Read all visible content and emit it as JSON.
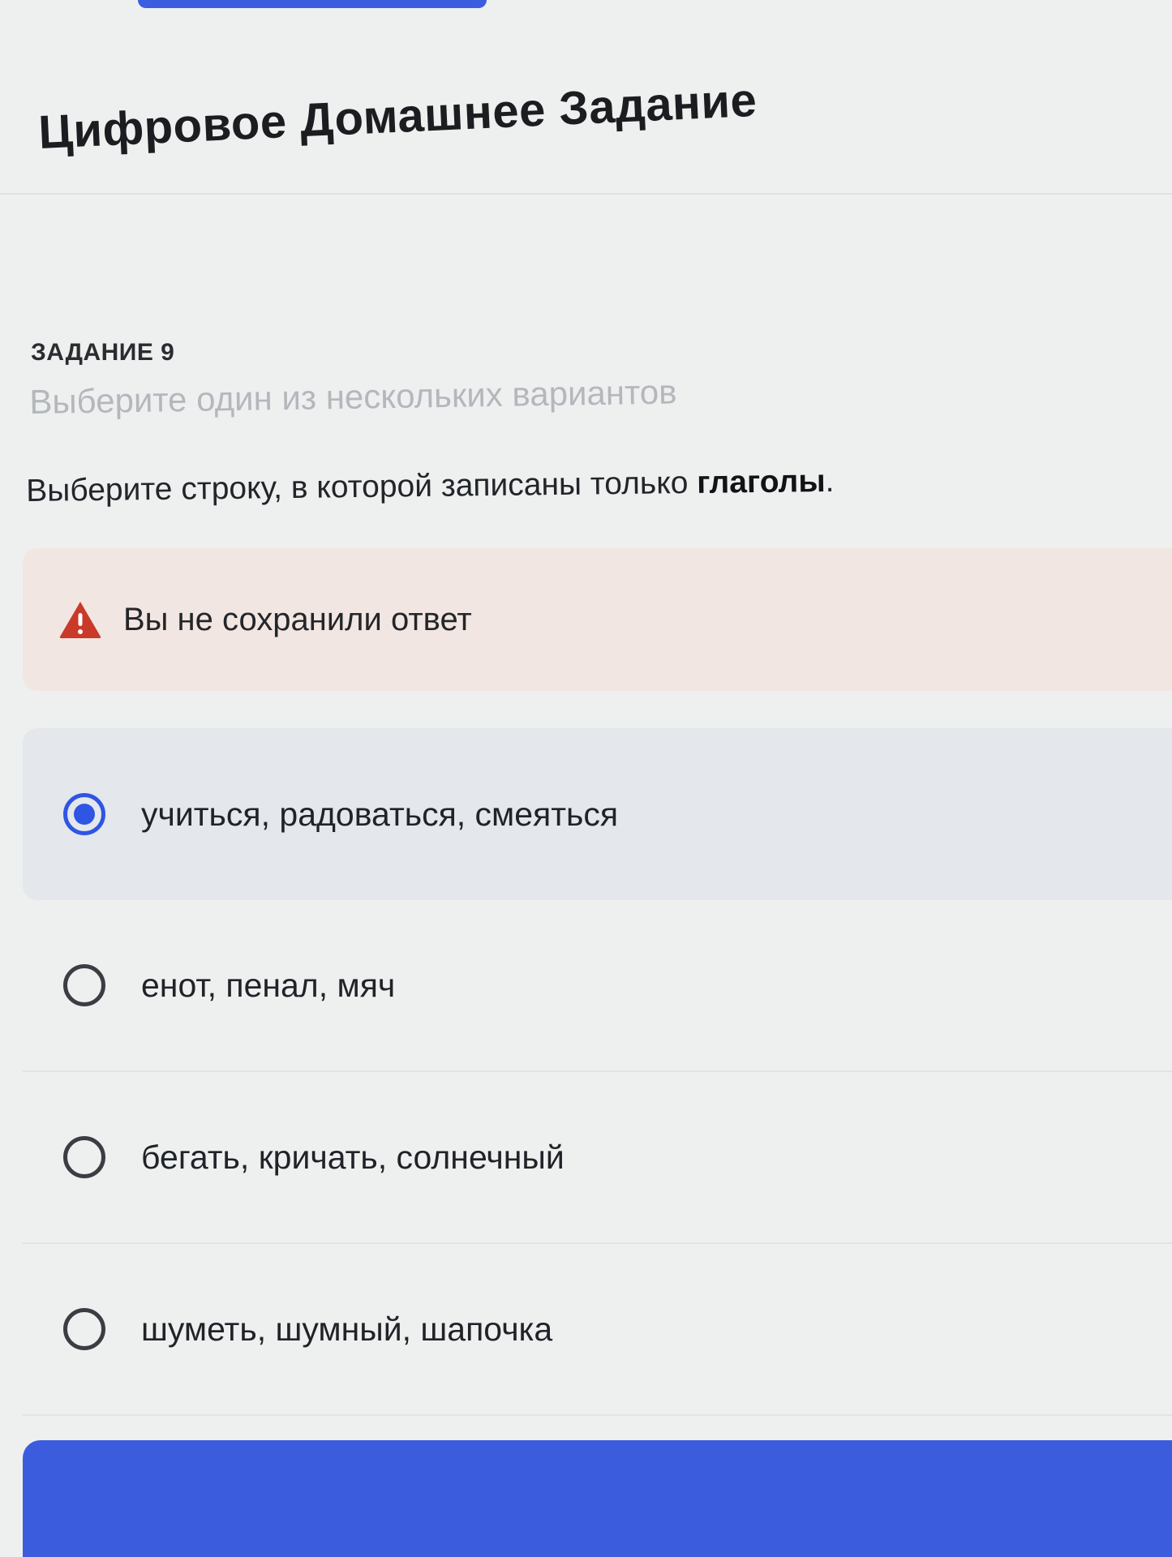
{
  "header": {
    "title": "Цифровое Домашнее Задание"
  },
  "task": {
    "number": "ЗАДАНИЕ 9",
    "hint": "Выберите один из нескольких вариантов",
    "question_prefix": "Выберите строку, в которой записаны только ",
    "question_bold": "глаголы",
    "question_suffix": "."
  },
  "warning": {
    "icon": "warning-triangle-icon",
    "text": "Вы не сохранили ответ",
    "color": "#c93a2a"
  },
  "options": [
    {
      "label": "учиться, радоваться, смеяться",
      "selected": true
    },
    {
      "label": "енот, пенал, мяч",
      "selected": false
    },
    {
      "label": "бегать, кричать, солнечный",
      "selected": false
    },
    {
      "label": "шуметь, шумный, шапочка",
      "selected": false
    }
  ],
  "colors": {
    "accent": "#2f55e4",
    "button": "#3b5ddd",
    "warning_bg": "#f2e6e2",
    "selected_bg": "#e4e7eb"
  },
  "save_button": {
    "label": ""
  }
}
